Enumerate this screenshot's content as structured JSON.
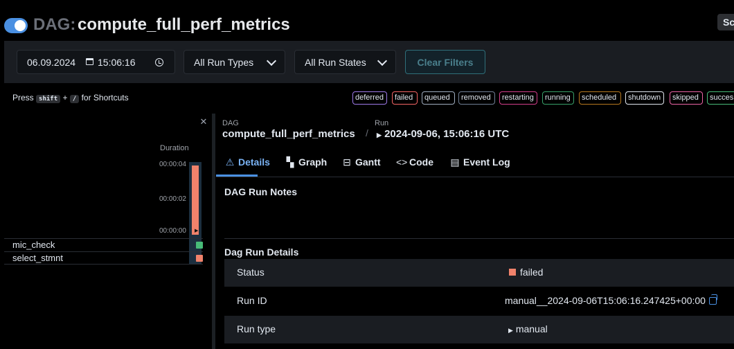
{
  "header": {
    "dag_prefix": "DAG:",
    "dag_id": "compute_full_perf_metrics",
    "right_button": "Sc"
  },
  "filters": {
    "date": "06.09.2024",
    "time": "15:06:16",
    "run_type": "All Run Types",
    "run_state": "All Run States",
    "clear_label": "Clear Filters"
  },
  "shortcut": {
    "press": "Press",
    "key1": "shift",
    "plus": "+",
    "key2": "/",
    "suffix": "for Shortcuts"
  },
  "legend": [
    {
      "label": "deferred",
      "color": "#9f7aea"
    },
    {
      "label": "failed",
      "color": "#f56565"
    },
    {
      "label": "queued",
      "color": "#a0aec0"
    },
    {
      "label": "removed",
      "color": "#718096"
    },
    {
      "label": "restarting",
      "color": "#d53f8c"
    },
    {
      "label": "running",
      "color": "#38a169"
    },
    {
      "label": "scheduled",
      "color": "#b7791f"
    },
    {
      "label": "shutdown",
      "color": "#e2e8f0"
    },
    {
      "label": "skipped",
      "color": "#ed64a6"
    },
    {
      "label": "succes",
      "color": "#48bb78"
    }
  ],
  "grid": {
    "duration_label": "Duration",
    "ticks": [
      "00:00:04",
      "00:00:02",
      "00:00:00"
    ],
    "run_duration_fraction": 1.0,
    "tasks": [
      {
        "name": "mic_check",
        "state_color": "#48bb78"
      },
      {
        "name": "select_stmnt",
        "state_color": "#f0826b"
      }
    ]
  },
  "breadcrumb": {
    "dag_label": "DAG",
    "dag_id": "compute_full_perf_metrics",
    "sep": "/",
    "run_label": "Run",
    "run_value": "2024-09-06, 15:06:16 UTC"
  },
  "tabs": [
    {
      "label": "Details",
      "icon": "warning-icon",
      "glyph": "⚠",
      "active": true
    },
    {
      "label": "Graph",
      "icon": "graph-icon",
      "glyph": "▚"
    },
    {
      "label": "Gantt",
      "icon": "gantt-icon",
      "glyph": "⊟"
    },
    {
      "label": "Code",
      "icon": "code-icon",
      "glyph": "<>"
    },
    {
      "label": "Event Log",
      "icon": "event-log-icon",
      "glyph": "▤"
    }
  ],
  "details": {
    "notes_title": "DAG Run Notes",
    "section_title": "Dag Run Details",
    "rows": [
      {
        "key": "Status",
        "value": "failed"
      },
      {
        "key": "Run ID",
        "value": "manual__2024-09-06T15:06:16.247425+00:00"
      },
      {
        "key": "Run type",
        "value": "manual"
      }
    ]
  },
  "colors": {
    "accent": "#4a90e2",
    "failed": "#f0826b",
    "success": "#48bb78",
    "row_stripe": "#1a1d22"
  }
}
